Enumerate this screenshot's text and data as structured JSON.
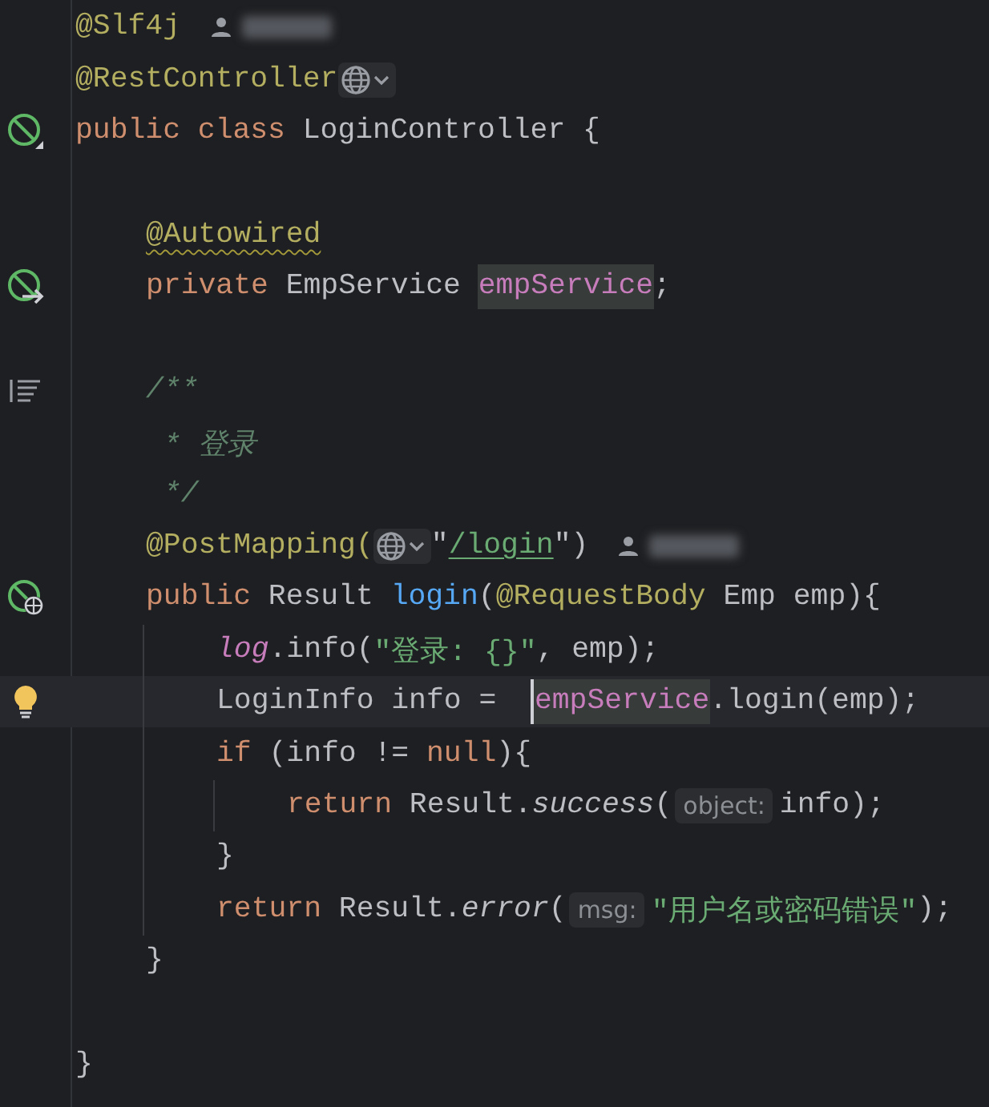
{
  "editor": {
    "lines": [
      {
        "kind": "code",
        "tokens": [
          {
            "kind": "annotation",
            "text": "@Slf4j"
          },
          {
            "kind": "author"
          }
        ]
      },
      {
        "kind": "code",
        "tokens": [
          {
            "kind": "annotation",
            "text": "@RestController"
          },
          {
            "kind": "globe"
          }
        ]
      },
      {
        "kind": "code",
        "gutter_icon": {
          "kind": "bean"
        },
        "tokens": [
          {
            "kind": "keyword",
            "text": "public class "
          },
          {
            "kind": "plain",
            "text": "LoginController {"
          }
        ],
        "children": [
          {
            "kind": "blank"
          },
          {
            "kind": "code",
            "tokens": [
              {
                "kind": "annotation",
                "text": "@Autowired",
                "warning": true
              }
            ]
          },
          {
            "kind": "code",
            "gutter_icon": {
              "kind": "inject"
            },
            "tokens": [
              {
                "kind": "keyword",
                "text": "private "
              },
              {
                "kind": "plain",
                "text": "EmpService "
              },
              {
                "kind": "field",
                "text": "empService",
                "usage": true
              },
              {
                "kind": "plain",
                "text": ";"
              }
            ]
          },
          {
            "kind": "blank"
          },
          {
            "kind": "code",
            "gutter_icon": {
              "kind": "doc"
            },
            "tokens": [
              {
                "kind": "comment",
                "text": "/**"
              }
            ]
          },
          {
            "kind": "code",
            "tokens": [
              {
                "kind": "comment",
                "text": " * 登录"
              }
            ]
          },
          {
            "kind": "code",
            "tokens": [
              {
                "kind": "comment",
                "text": " */"
              }
            ]
          },
          {
            "kind": "code",
            "tokens": [
              {
                "kind": "annotation",
                "text": "@PostMapping("
              },
              {
                "kind": "globe"
              },
              {
                "kind": "plain",
                "text": "\""
              },
              {
                "kind": "link",
                "text": "/login"
              },
              {
                "kind": "plain",
                "text": "\")"
              },
              {
                "kind": "author"
              }
            ]
          },
          {
            "kind": "code",
            "gutter_icon": {
              "kind": "endpoint"
            },
            "tokens": [
              {
                "kind": "keyword",
                "text": "public "
              },
              {
                "kind": "plain",
                "text": "Result "
              },
              {
                "kind": "method",
                "text": "login"
              },
              {
                "kind": "plain",
                "text": "("
              },
              {
                "kind": "annotation",
                "text": "@RequestBody"
              },
              {
                "kind": "plain",
                "text": " Emp emp){"
              }
            ],
            "children": [
              {
                "kind": "code",
                "tokens": [
                  {
                    "kind": "static-field",
                    "text": "log"
                  },
                  {
                    "kind": "plain",
                    "text": ".info("
                  },
                  {
                    "kind": "string",
                    "text": "\"登录: {}\""
                  },
                  {
                    "kind": "plain",
                    "text": ", emp);"
                  }
                ]
              },
              {
                "kind": "code",
                "current": true,
                "gutter_icon": {
                  "kind": "bulb"
                },
                "tokens": [
                  {
                    "kind": "plain",
                    "text": "LoginInfo info =  "
                  },
                  {
                    "kind": "field",
                    "text": "empService",
                    "usage": true,
                    "caret": true
                  },
                  {
                    "kind": "plain",
                    "text": ".login(emp);"
                  }
                ]
              },
              {
                "kind": "code",
                "tokens": [
                  {
                    "kind": "keyword",
                    "text": "if "
                  },
                  {
                    "kind": "plain",
                    "text": "(info != "
                  },
                  {
                    "kind": "keyword",
                    "text": "null"
                  },
                  {
                    "kind": "plain",
                    "text": "){"
                  }
                ],
                "children": [
                  {
                    "kind": "code",
                    "tokens": [
                      {
                        "kind": "keyword",
                        "text": "return "
                      },
                      {
                        "kind": "plain",
                        "text": "Result."
                      },
                      {
                        "kind": "static",
                        "text": "success"
                      },
                      {
                        "kind": "plain",
                        "text": "("
                      },
                      {
                        "kind": "hint",
                        "text": "object:"
                      },
                      {
                        "kind": "plain",
                        "text": "info);"
                      }
                    ]
                  }
                ]
              },
              {
                "kind": "code",
                "tokens": [
                  {
                    "kind": "plain",
                    "text": "}"
                  }
                ]
              },
              {
                "kind": "code",
                "tokens": [
                  {
                    "kind": "keyword",
                    "text": "return "
                  },
                  {
                    "kind": "plain",
                    "text": "Result."
                  },
                  {
                    "kind": "static",
                    "text": "error"
                  },
                  {
                    "kind": "plain",
                    "text": "("
                  },
                  {
                    "kind": "hint",
                    "text": "msg:"
                  },
                  {
                    "kind": "string",
                    "text": "\"用户名或密码错误\""
                  },
                  {
                    "kind": "plain",
                    "text": ");"
                  }
                ]
              }
            ]
          },
          {
            "kind": "code",
            "tokens": [
              {
                "kind": "plain",
                "text": "}"
              }
            ]
          },
          {
            "kind": "blank"
          }
        ]
      },
      {
        "kind": "code",
        "tokens": [
          {
            "kind": "plain",
            "text": "}"
          }
        ]
      }
    ]
  }
}
